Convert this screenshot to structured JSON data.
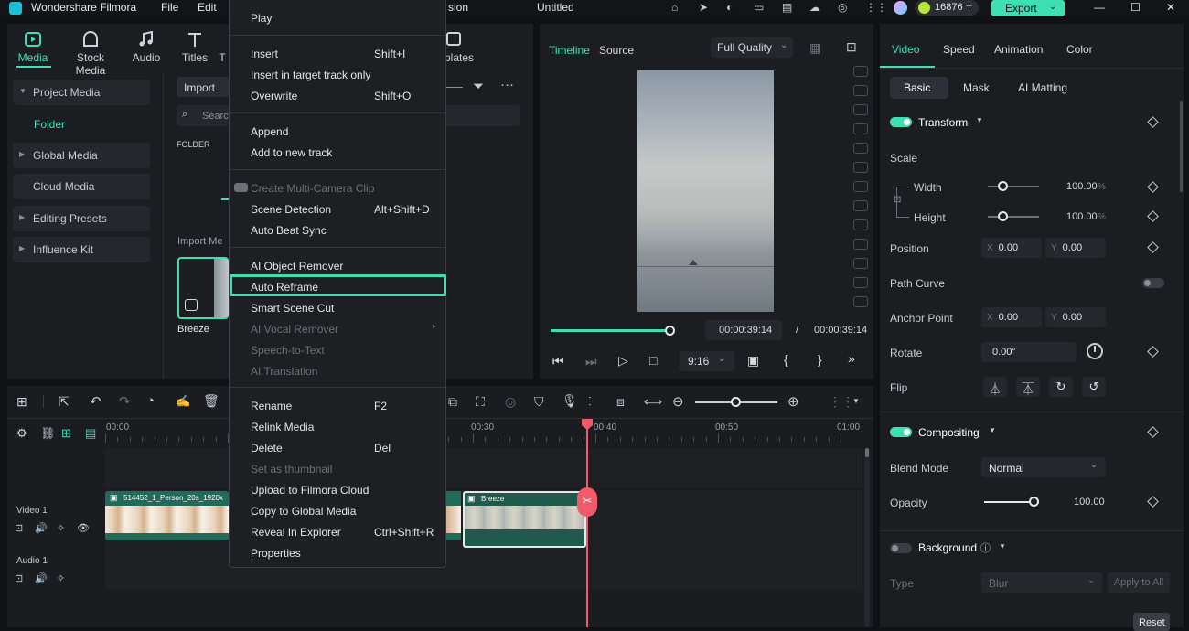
{
  "titlebar": {
    "app_name": "Wondershare Filmora",
    "menu_file": "File",
    "menu_edit": "Edit",
    "menu_partial": "sion",
    "project_title": "Untitled",
    "credits": "16876",
    "export_label": "Export"
  },
  "media_tabs": [
    {
      "label": "Media",
      "icon": "media-icon"
    },
    {
      "label": "Stock Media",
      "icon": "stock-media-icon"
    },
    {
      "label": "Audio",
      "icon": "audio-icon"
    },
    {
      "label": "Titles",
      "icon": "titles-icon"
    },
    {
      "label": "T",
      "icon": "transitions-icon"
    },
    {
      "label": "plates",
      "icon": "templates-icon"
    }
  ],
  "sidebar": {
    "items": [
      {
        "label": "Project Media"
      },
      {
        "label": "Folder"
      },
      {
        "label": "Global Media"
      },
      {
        "label": "Cloud Media"
      },
      {
        "label": "Editing Presets"
      },
      {
        "label": "Influence Kit"
      }
    ]
  },
  "media_panel": {
    "import_label": "Import",
    "search_placeholder": "Search",
    "folder_header": "FOLDER",
    "import_media_label": "Import Me",
    "clip_name": "Breeze"
  },
  "context_menu": {
    "play": "Play",
    "insert": "Insert",
    "insert_shortcut": "Shift+I",
    "insert_target": "Insert in target track only",
    "overwrite": "Overwrite",
    "overwrite_shortcut": "Shift+O",
    "append": "Append",
    "add_new_track": "Add to new track",
    "multi_camera": "Create Multi-Camera Clip",
    "scene_detection": "Scene Detection",
    "scene_detection_shortcut": "Alt+Shift+D",
    "auto_beat_sync": "Auto Beat Sync",
    "ai_object_remover": "AI Object Remover",
    "auto_reframe": "Auto Reframe",
    "smart_scene_cut": "Smart Scene Cut",
    "ai_vocal_remover": "AI Vocal Remover",
    "speech_to_text": "Speech-to-Text",
    "ai_translation": "AI Translation",
    "rename": "Rename",
    "rename_shortcut": "F2",
    "relink_media": "Relink Media",
    "delete": "Delete",
    "delete_shortcut": "Del",
    "set_thumbnail": "Set as thumbnail",
    "upload_cloud": "Upload to Filmora Cloud",
    "copy_global": "Copy to Global Media",
    "reveal_explorer": "Reveal In Explorer",
    "reveal_shortcut": "Ctrl+Shift+R",
    "properties": "Properties"
  },
  "preview": {
    "tab_timeline": "Timeline",
    "tab_source": "Source",
    "quality": "Full Quality",
    "current_time": "00:00:39:14",
    "separator": "/",
    "total_time": "00:00:39:14",
    "aspect_ratio": "9:16",
    "brace_open": "{",
    "brace_close": "}",
    "progress": 1.0
  },
  "timeline": {
    "ruler": [
      "00:00",
      "00:30",
      "00:40",
      "00:50",
      "01:00"
    ],
    "video_track_label": "Video 1",
    "audio_track_label": "Audio 1",
    "clip1_name": "514452_1_Person_20s_1920x",
    "clip2_name": "Breeze",
    "zoom_level": 0.5
  },
  "properties": {
    "tabs": [
      "Video",
      "Speed",
      "Animation",
      "Color"
    ],
    "subtabs": [
      "Basic",
      "Mask",
      "AI Matting"
    ],
    "transform_label": "Transform",
    "scale_label": "Scale",
    "width_label": "Width",
    "width_value": "100.00",
    "width_unit": "%",
    "height_label": "Height",
    "height_value": "100.00",
    "height_unit": "%",
    "position_label": "Position",
    "pos_x_label": "X",
    "pos_x": "0.00",
    "pos_y_label": "Y",
    "pos_y": "0.00",
    "path_curve_label": "Path Curve",
    "anchor_label": "Anchor Point",
    "anchor_x": "0.00",
    "anchor_y": "0.00",
    "rotate_label": "Rotate",
    "rotate_value": "0.00°",
    "flip_label": "Flip",
    "compositing_label": "Compositing",
    "blend_label": "Blend Mode",
    "blend_value": "Normal",
    "opacity_label": "Opacity",
    "opacity_value": "100.00",
    "background_label": "Background",
    "type_label": "Type",
    "type_value": "Blur",
    "apply_all": "Apply to All",
    "reset": "Reset"
  },
  "colors": {
    "accent": "#3ee0b3",
    "playhead": "#f05a6a",
    "panel": "#1b1d21"
  }
}
